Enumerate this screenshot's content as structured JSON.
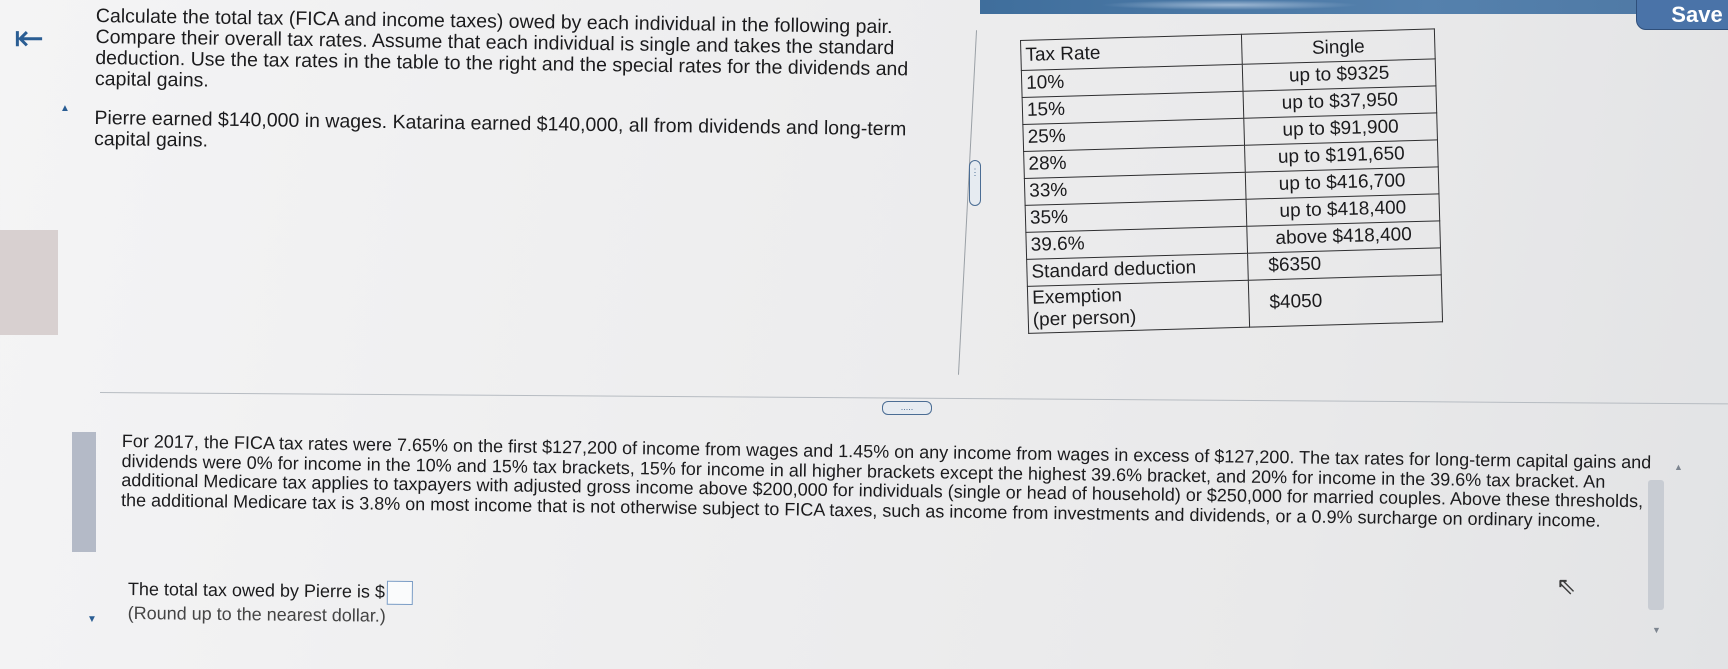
{
  "header": {
    "save_label": "Save",
    "back_icon": "back-arrow-icon"
  },
  "problem": {
    "paragraph1": "Calculate the total tax (FICA and income taxes) owed by each individual in the following pair. Compare their overall tax rates. Assume that each individual is single and takes the standard deduction. Use the tax rates in the table to the right and the special rates for the dividends and capital gains.",
    "paragraph2": "Pierre earned $140,000 in wages. Katarina earned $140,000, all from dividends and long-term capital gains."
  },
  "tax_table": {
    "header_rate": "Tax Rate",
    "header_single": "Single",
    "rows": [
      {
        "rate": "10%",
        "value": "up to $9325"
      },
      {
        "rate": "15%",
        "value": "up to $37,950"
      },
      {
        "rate": "25%",
        "value": "up to $91,900"
      },
      {
        "rate": "28%",
        "value": "up to $191,650"
      },
      {
        "rate": "33%",
        "value": "up to $416,700"
      },
      {
        "rate": "35%",
        "value": "up to $418,400"
      },
      {
        "rate": "39.6%",
        "value": "above $418,400"
      },
      {
        "rate": "Standard deduction",
        "value": "$6350"
      }
    ],
    "exemption_label_line1": "Exemption",
    "exemption_label_line2": "(per person)",
    "exemption_value": "$4050"
  },
  "info": {
    "text": "For 2017, the FICA tax rates were 7.65% on the first $127,200 of income from wages and 1.45% on any income from wages in excess of $127,200. The tax rates for long-term capital gains and dividends were 0% for income in the 10% and 15% tax brackets, 15% for income in all higher brackets except the highest 39.6% bracket, and 20% for income in the 39.6% tax bracket. An additional Medicare tax applies to taxpayers with adjusted gross income above $200,000 for individuals (single or head of household) or $250,000 for married couples. Above these thresholds, the additional Medicare tax is 3.8% on most income that is not otherwise subject to FICA taxes, such as income from investments and dividends, or a 0.9% surcharge on ordinary income."
  },
  "answer": {
    "prompt": "The total tax owed by Pierre is $",
    "hint": "(Round up to the nearest dollar.)",
    "value": ""
  },
  "handles": {
    "dots": "....."
  }
}
